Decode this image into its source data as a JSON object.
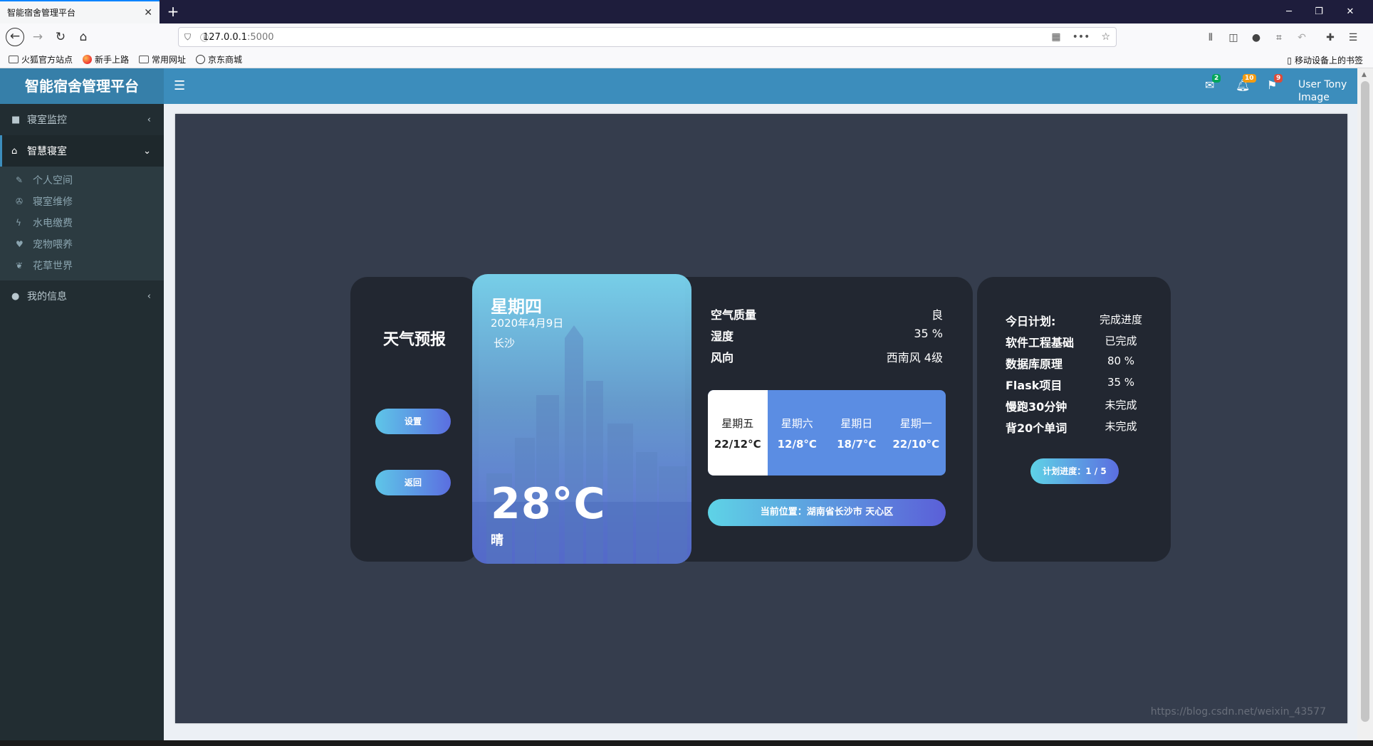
{
  "browser": {
    "tab_title": "智能宿舍管理平台",
    "tab_close": "✕",
    "new_tab": "+",
    "window_controls": {
      "minimize": "─",
      "restore": "❐",
      "close": "✕"
    },
    "url_host": "127.0.0.1",
    "url_port": ":5000",
    "bookmarks": [
      "火狐官方站点",
      "新手上路",
      "常用网址",
      "京东商城"
    ],
    "mobile_bookmarks": "移动设备上的书签"
  },
  "app": {
    "logo": "智能宿舍管理平台",
    "topbar": {
      "mail_badge": "2",
      "bell_badge": "10",
      "flag_badge": "9",
      "user_line1": "User Tony",
      "user_line2": "Image"
    },
    "sidebar": {
      "items": [
        {
          "label": "寝室监控",
          "icon": "video-icon"
        },
        {
          "label": "智慧寝室",
          "icon": "home-icon"
        },
        {
          "label": "我的信息",
          "icon": "user-icon"
        }
      ],
      "subitems": [
        {
          "label": "个人空间",
          "icon": "pin-icon"
        },
        {
          "label": "寝室维修",
          "icon": "wrench-icon"
        },
        {
          "label": "水电缴费",
          "icon": "bolt-icon"
        },
        {
          "label": "宠物喂养",
          "icon": "heart-icon"
        },
        {
          "label": "花草世界",
          "icon": "leaf-icon"
        }
      ]
    }
  },
  "weather": {
    "title": "天气预报",
    "settings_button": "设置",
    "back_button": "返回",
    "day": "星期四",
    "date": "2020年4月9日",
    "city": "长沙",
    "temperature": "28°C",
    "condition": "晴",
    "stats": [
      {
        "key": "空气质量",
        "value": "良"
      },
      {
        "key": "湿度",
        "value": "35 %"
      },
      {
        "key": "风向",
        "value": "西南风 4级"
      }
    ],
    "forecast": [
      {
        "day": "星期五",
        "temp": "22/12°C"
      },
      {
        "day": "星期六",
        "temp": "12/8°C"
      },
      {
        "day": "星期日",
        "temp": "18/7°C"
      },
      {
        "day": "星期一",
        "temp": "22/10°C"
      }
    ],
    "location": "当前位置：湖南省长沙市 天心区"
  },
  "plan": {
    "header_key": "今日计划:",
    "header_value": "完成进度",
    "rows": [
      {
        "key": "软件工程基础",
        "value": "已完成"
      },
      {
        "key": "数据库原理",
        "value": "80 %"
      },
      {
        "key": "Flask项目",
        "value": "35 %"
      },
      {
        "key": "慢跑30分钟",
        "value": "未完成"
      },
      {
        "key": "背20个单词",
        "value": "未完成"
      }
    ],
    "progress": "计划进度：1 / 5"
  },
  "watermark": "https://blog.csdn.net/weixin_43577"
}
